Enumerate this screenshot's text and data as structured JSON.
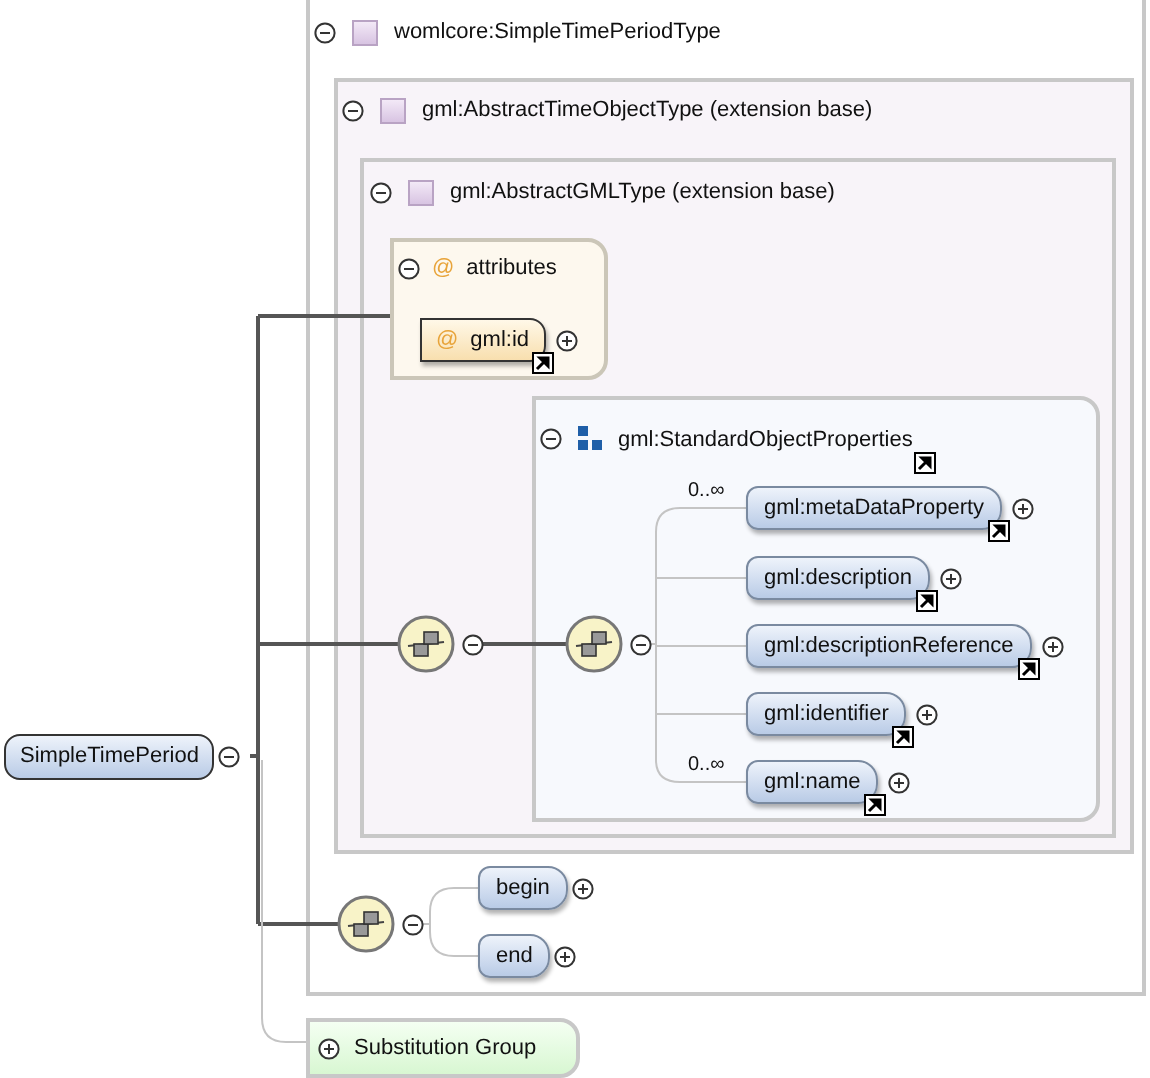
{
  "root": {
    "name": "SimpleTimePeriod",
    "expanded": true
  },
  "type": {
    "title": "womlcore:SimpleTimePeriodType",
    "expanded": true
  },
  "base_types": [
    {
      "title": "gml:AbstractTimeObjectType (extension base)",
      "expanded": true
    },
    {
      "title": "gml:AbstractGMLType (extension base)",
      "expanded": true
    }
  ],
  "attributes": {
    "title": "attributes",
    "marker": "@",
    "expanded": true,
    "items": [
      {
        "name": "gml:id",
        "marker": "@",
        "reference": true,
        "expanded": false
      }
    ]
  },
  "sequences": [
    {
      "expanded": true
    },
    {
      "expanded": true
    },
    {
      "expanded": true
    }
  ],
  "group": {
    "title": "gml:StandardObjectProperties",
    "expanded": true,
    "reference": true,
    "elements": [
      {
        "name": "gml:metaDataProperty",
        "occurs": "0..∞",
        "reference": true,
        "expanded": false
      },
      {
        "name": "gml:description",
        "reference": true,
        "expanded": false
      },
      {
        "name": "gml:descriptionReference",
        "reference": true,
        "expanded": false
      },
      {
        "name": "gml:identifier",
        "reference": true,
        "expanded": false
      },
      {
        "name": "gml:name",
        "occurs": "0..∞",
        "reference": true,
        "expanded": false
      }
    ]
  },
  "time_elements": [
    {
      "name": "begin",
      "reference": false,
      "expanded": false
    },
    {
      "name": "end",
      "reference": false,
      "expanded": false
    }
  ],
  "substitution_group": {
    "label": "Substitution Group",
    "expanded": false
  }
}
